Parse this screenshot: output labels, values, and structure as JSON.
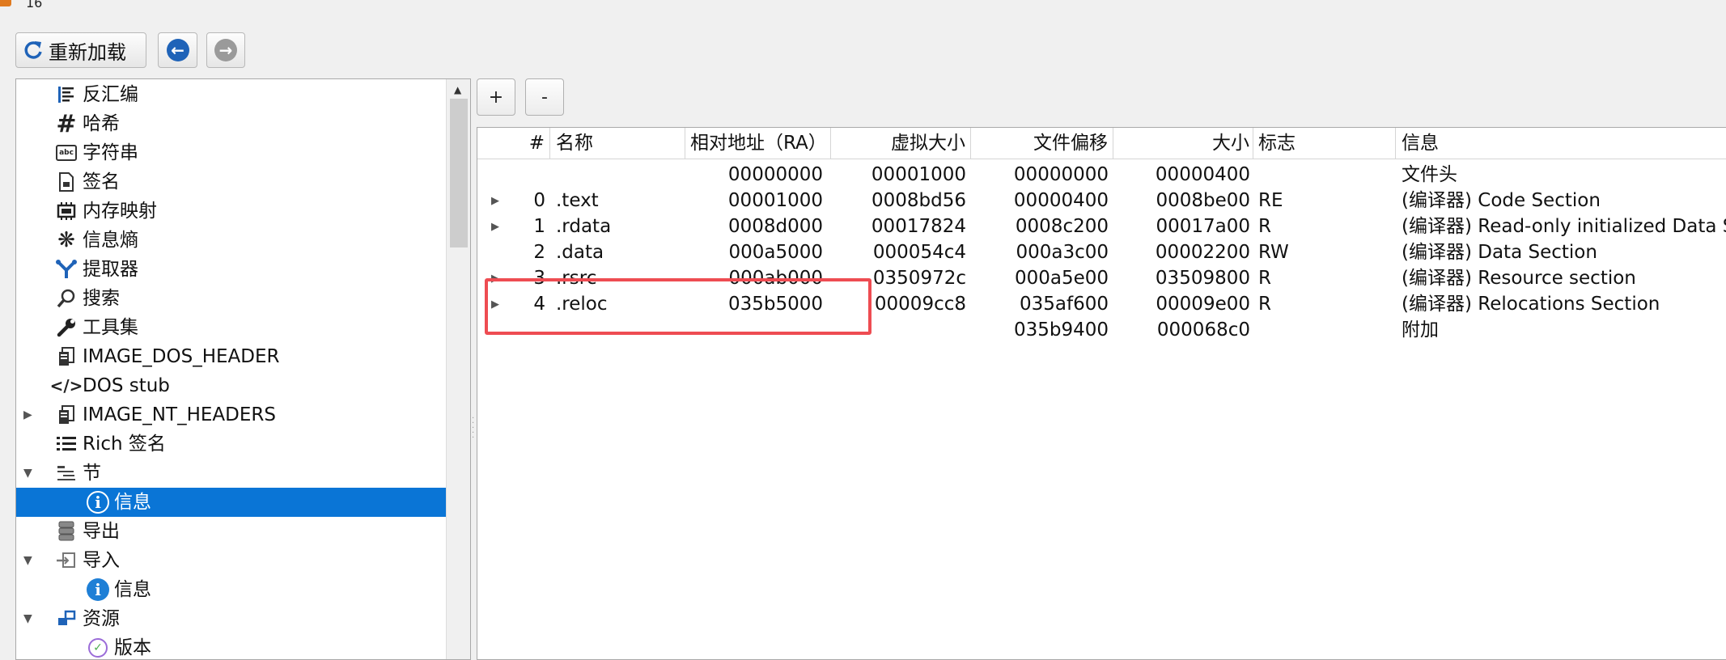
{
  "window": {
    "title": "16"
  },
  "toolbar": {
    "reload_label": "重新加载",
    "back_icon": "back-arrow-icon",
    "forward_icon": "forward-arrow-icon"
  },
  "tree": {
    "items": [
      {
        "label": "反汇编",
        "icon": "disassembly-icon"
      },
      {
        "label": "哈希",
        "icon": "hash-icon"
      },
      {
        "label": "字符串",
        "icon": "strings-icon"
      },
      {
        "label": "签名",
        "icon": "signature-icon"
      },
      {
        "label": "内存映射",
        "icon": "memory-map-icon"
      },
      {
        "label": "信息熵",
        "icon": "entropy-icon"
      },
      {
        "label": "提取器",
        "icon": "extractor-icon"
      },
      {
        "label": "搜索",
        "icon": "search-icon"
      },
      {
        "label": "工具集",
        "icon": "tools-icon"
      },
      {
        "label": "IMAGE_DOS_HEADER",
        "icon": "header-icon"
      },
      {
        "label": "DOS stub",
        "icon": "code-icon"
      },
      {
        "label": "IMAGE_NT_HEADERS",
        "icon": "header-icon"
      },
      {
        "label": "Rich 签名",
        "icon": "list-icon"
      },
      {
        "label": "节",
        "icon": "sections-icon"
      },
      {
        "label": "信息",
        "icon": "info-icon"
      },
      {
        "label": "导出",
        "icon": "export-icon"
      },
      {
        "label": "导入",
        "icon": "import-icon"
      },
      {
        "label": "信息",
        "icon": "info-icon"
      },
      {
        "label": "资源",
        "icon": "resources-icon"
      },
      {
        "label": "版本",
        "icon": "version-icon"
      }
    ]
  },
  "buttons": {
    "plus": "+",
    "minus": "-"
  },
  "table": {
    "headers": [
      "#",
      "名称",
      "相对地址（RA）",
      "虚拟大小",
      "文件偏移",
      "大小",
      "标志",
      "信息"
    ],
    "rows": [
      {
        "num": "",
        "name": "",
        "ra": "00000000",
        "vsize": "00001000",
        "offset": "00000000",
        "size": "00000400",
        "flags": "",
        "info": "文件头"
      },
      {
        "num": "0",
        "name": ".text",
        "ra": "00001000",
        "vsize": "0008bd56",
        "offset": "00000400",
        "size": "0008be00",
        "flags": "RE",
        "info": "(编译器) Code Section"
      },
      {
        "num": "1",
        "name": ".rdata",
        "ra": "0008d000",
        "vsize": "00017824",
        "offset": "0008c200",
        "size": "00017a00",
        "flags": "R",
        "info": "(编译器) Read-only initialized Data Se"
      },
      {
        "num": "2",
        "name": ".data",
        "ra": "000a5000",
        "vsize": "000054c4",
        "offset": "000a3c00",
        "size": "00002200",
        "flags": "RW",
        "info": "(编译器) Data Section"
      },
      {
        "num": "3",
        "name": ".rsrc",
        "ra": "000ab000",
        "vsize": "0350972c",
        "offset": "000a5e00",
        "size": "03509800",
        "flags": "R",
        "info": "(编译器) Resource section"
      },
      {
        "num": "4",
        "name": ".reloc",
        "ra": "035b5000",
        "vsize": "00009cc8",
        "offset": "035af600",
        "size": "00009e00",
        "flags": "R",
        "info": "(编译器) Relocations Section"
      },
      {
        "num": "",
        "name": "",
        "ra": "",
        "vsize": "",
        "offset": "035b9400",
        "size": "000068c0",
        "flags": "",
        "info": "附加"
      }
    ]
  },
  "colors": {
    "selection": "#0a75d6",
    "highlight_box": "#ee4c52",
    "accent": "#1f63b8"
  }
}
